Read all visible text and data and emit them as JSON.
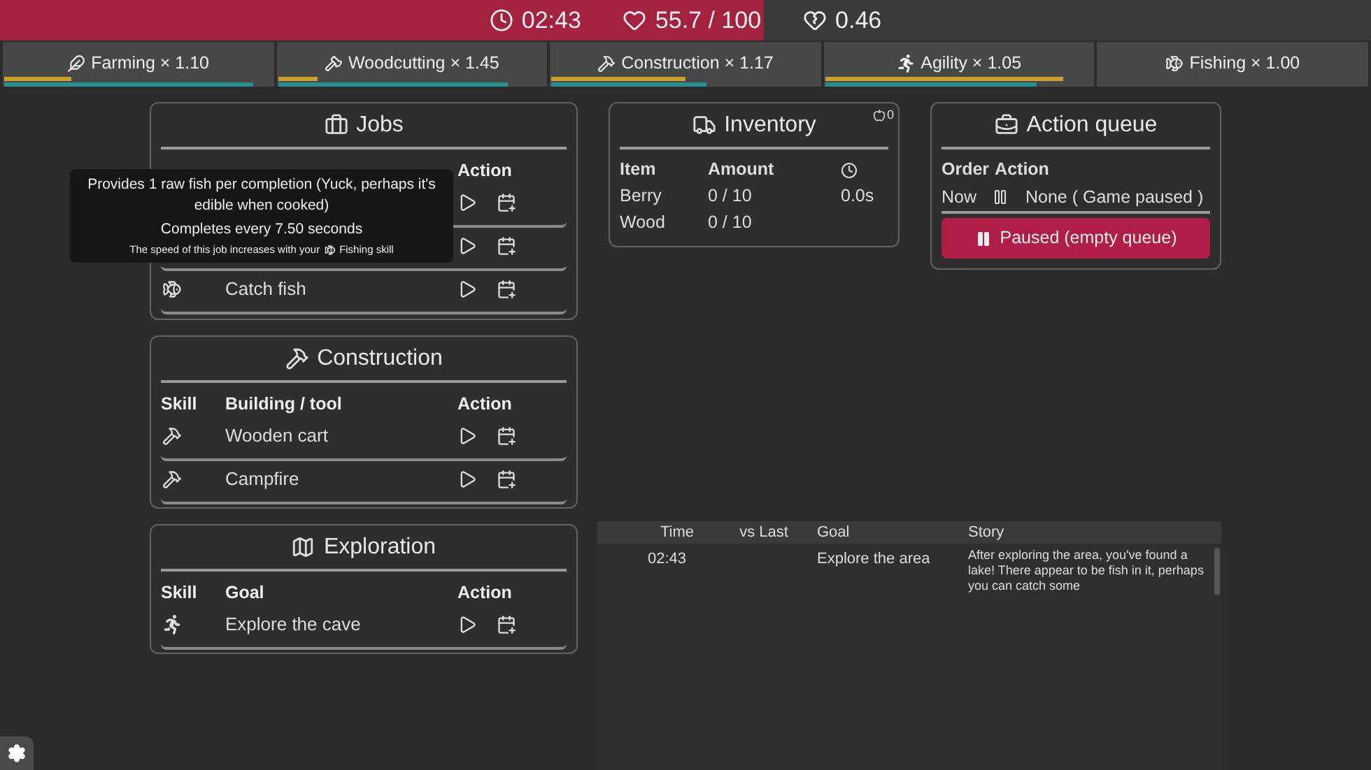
{
  "status_bar": {
    "time": "02:43",
    "health": "55.7 / 100",
    "regen": "0.46",
    "health_bar": {
      "level": 0.557
    }
  },
  "skills": [
    {
      "kind": "farming",
      "label": "Farming × 1.10",
      "bars": [
        {
          "kind": "level",
          "level": 0.25
        },
        {
          "kind": "xp",
          "level": 0.93
        }
      ]
    },
    {
      "kind": "woodcutting",
      "label": "Woodcutting × 1.45",
      "bars": [
        {
          "kind": "level",
          "level": 0.15
        },
        {
          "kind": "xp",
          "level": 0.86
        }
      ]
    },
    {
      "kind": "construction",
      "label": "Construction × 1.17",
      "bars": [
        {
          "kind": "level",
          "level": 0.5
        },
        {
          "kind": "xp",
          "level": 0.58
        }
      ]
    },
    {
      "kind": "agility",
      "label": "Agility × 1.05",
      "bars": [
        {
          "kind": "level",
          "level": 0.89
        },
        {
          "kind": "xp",
          "level": 0.79
        }
      ]
    },
    {
      "kind": "fishing",
      "label": "Fishing × 1.00"
    }
  ],
  "jobs": {
    "title": "Jobs",
    "columns": [
      "Action"
    ],
    "rows": [
      {
        "kind": "covered"
      },
      {
        "kind": "covered"
      },
      {
        "kind": "fishing",
        "name": "Catch fish"
      }
    ],
    "tooltip": {
      "description": "Provides 1 raw fish per completion (Yuck, perhaps it's edible when cooked)",
      "duration": "Completes every 7.50 seconds",
      "note": "The speed of this job increases with your",
      "skill_name": "Fishing skill"
    }
  },
  "construction": {
    "title": "Construction",
    "columns": [
      "Skill",
      "Building / tool",
      "Action"
    ],
    "rows": [
      {
        "kind": "construction",
        "name": "Wooden cart"
      },
      {
        "kind": "construction",
        "name": "Campfire"
      }
    ]
  },
  "exploration": {
    "title": "Exploration",
    "columns": [
      "Skill",
      "Goal",
      "Action"
    ],
    "rows": [
      {
        "kind": "agility",
        "name": "Explore the cave"
      }
    ]
  },
  "inventory": {
    "title": "Inventory",
    "food_count": "0",
    "columns": [
      "Item",
      "Amount"
    ],
    "rows": [
      {
        "item": "Berry",
        "amount": "0 / 10",
        "time": "0.0s"
      },
      {
        "item": "Wood",
        "amount": "0 / 10"
      }
    ]
  },
  "action_queue": {
    "title": "Action queue",
    "columns": [
      "Order",
      "Action"
    ],
    "rows": [
      {
        "order": "Now",
        "action": "None ( Game paused )"
      }
    ],
    "button": "Paused (empty queue)"
  },
  "log": {
    "columns": [
      "Time",
      "vs Last",
      "Goal",
      "Story"
    ],
    "rows": [
      {
        "time": "02:43",
        "goal": "Explore the area",
        "story": "After exploring the area, you've found a lake! There appear to be fish in it, perhaps you can catch some"
      }
    ]
  }
}
